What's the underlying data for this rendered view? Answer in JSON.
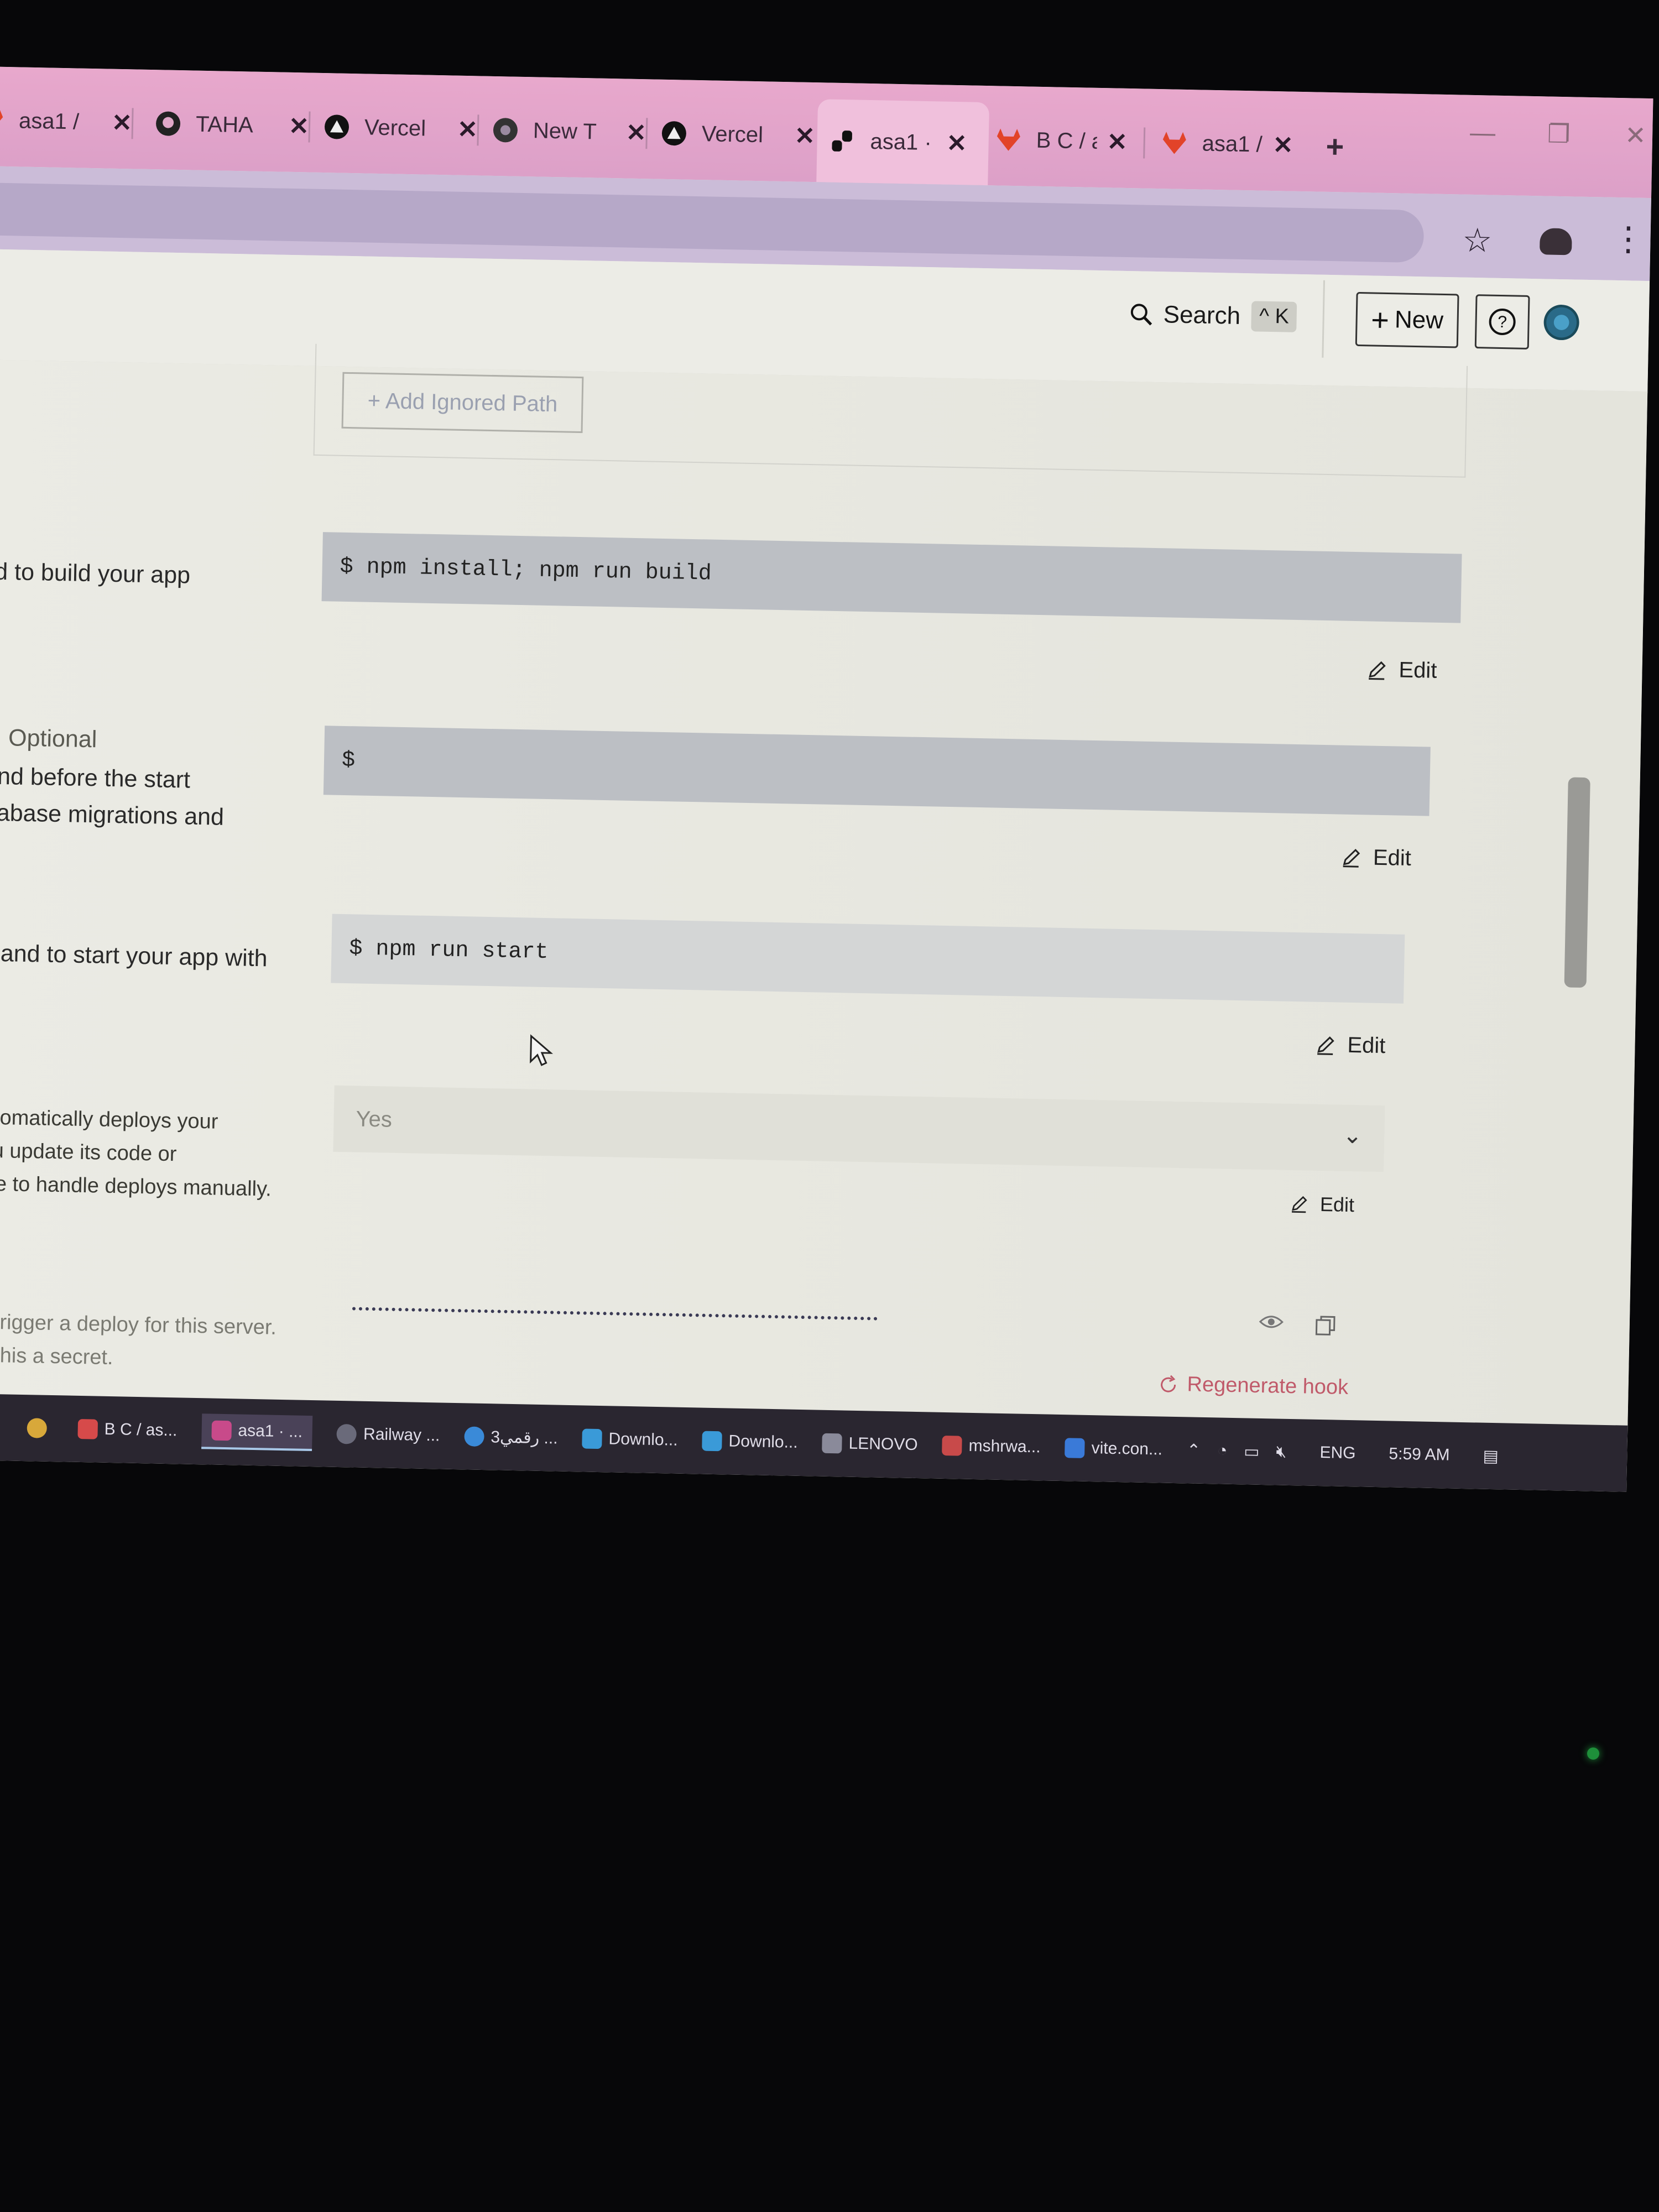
{
  "tabs": [
    {
      "label": "asa1 /",
      "icon": "gitlab-icon",
      "active": false
    },
    {
      "label": "TAHA",
      "icon": "github-icon",
      "active": false
    },
    {
      "label": "Vercel",
      "icon": "vercel-icon",
      "active": false
    },
    {
      "label": "New T",
      "icon": "chrome-icon",
      "active": false
    },
    {
      "label": "Vercel",
      "icon": "vercel-icon",
      "active": false
    },
    {
      "label": "asa1 ·",
      "icon": "render-icon",
      "active": true
    },
    {
      "label": "B C / a",
      "icon": "gitlab-icon",
      "active": false
    },
    {
      "label": "asa1 /",
      "icon": "gitlab-icon",
      "active": false
    }
  ],
  "header": {
    "search_label": "Search",
    "search_shortcut": "^ K",
    "new_label": "New"
  },
  "ignored": {
    "add_label": "+ Add Ignored Path"
  },
  "build": {
    "desc": "and to build your app",
    "command": "$ npm install; npm run build",
    "edit_label": "Edit"
  },
  "predeploy": {
    "title_fragment": "nd",
    "optional_label": "Optional",
    "desc_line1": "mand before the start",
    "desc_line2": "database migrations and",
    "command": "$",
    "edit_label": "Edit"
  },
  "start": {
    "desc": "mmand to start your app with",
    "command": "$ npm run start",
    "edit_label": "Edit"
  },
  "autodeploy": {
    "desc_line1": "r automatically deploys your",
    "desc_line2": "r you update its code or",
    "desc_line3": "sable to handle deploys manually.",
    "value": "Yes",
    "edit_label": "Edit"
  },
  "deploy_hook": {
    "desc_line1": "L to trigger a deploy for this server.",
    "desc_line2": "eep this a secret.",
    "regenerate_label": "Regenerate hook"
  },
  "taskbar": {
    "items": [
      {
        "label": "B C / as...",
        "color": "#d64a4a"
      },
      {
        "label": "asa1 · ...",
        "color": "#c84a8a"
      },
      {
        "label": "Railway ...",
        "color": "#6a6a7a"
      },
      {
        "label": "رقمي3 ...",
        "color": "#3a8ad8"
      },
      {
        "label": "Downlo...",
        "color": "#3a9ad8"
      },
      {
        "label": "Downlo...",
        "color": "#3a9ad8"
      },
      {
        "label": "LENOVO",
        "color": "#8a8a9a"
      },
      {
        "label": "mshrwa...",
        "color": "#c84a4a"
      },
      {
        "label": "vite.con...",
        "color": "#3a7ad8"
      }
    ],
    "lang": "ENG",
    "time": "5:59 AM"
  }
}
